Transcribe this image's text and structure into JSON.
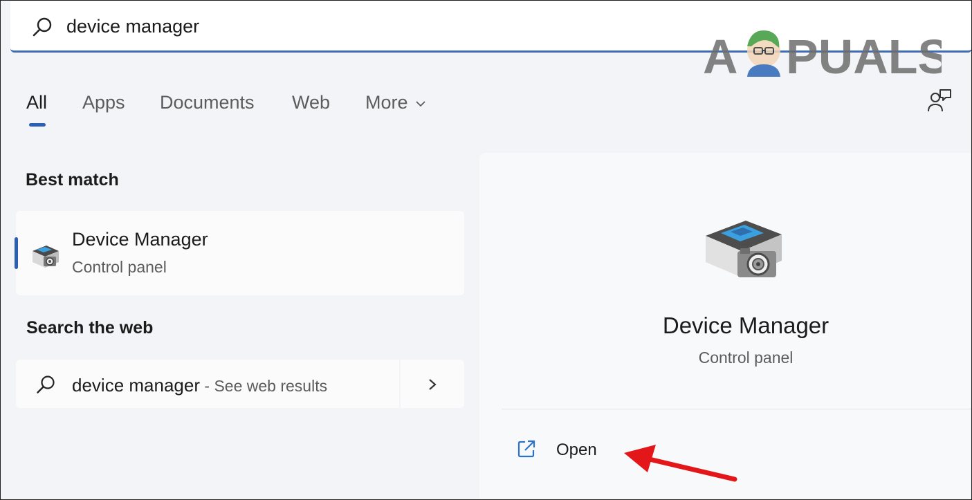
{
  "search": {
    "query": "device manager"
  },
  "watermark": {
    "text": "A PUALS"
  },
  "tabs": [
    {
      "label": "All",
      "active": true
    },
    {
      "label": "Apps",
      "active": false
    },
    {
      "label": "Documents",
      "active": false
    },
    {
      "label": "Web",
      "active": false
    },
    {
      "label": "More",
      "active": false
    }
  ],
  "best_match": {
    "heading": "Best match",
    "title": "Device Manager",
    "subtitle": "Control panel"
  },
  "search_web": {
    "heading": "Search the web",
    "query": "device manager",
    "hint": " - See web results"
  },
  "detail": {
    "title": "Device Manager",
    "subtitle": "Control panel",
    "open_label": "Open"
  },
  "colors": {
    "accent": "#2b5fb4",
    "annotation_arrow": "#e3171a"
  }
}
